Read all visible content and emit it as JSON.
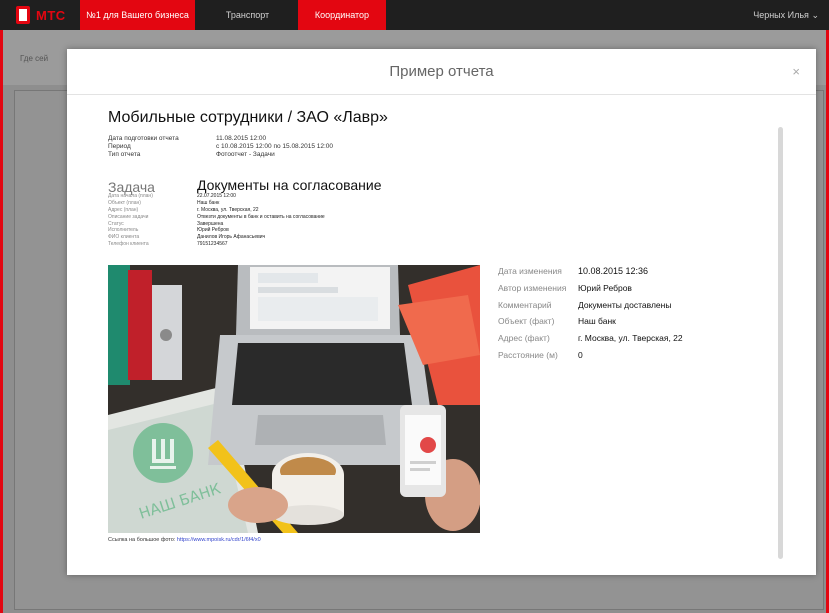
{
  "topbar": {
    "logo_text": "МТС",
    "tabs": [
      "№1 для Вашего бизнеса",
      "Транспорт",
      "Координатор"
    ],
    "user_name": "Черных Илья"
  },
  "background": {
    "where_label": "Где сей"
  },
  "modal": {
    "title": "Пример отчета",
    "close_glyph": "×"
  },
  "report": {
    "title": "Мобильные сотрудники / ЗАО «Лавр»",
    "meta": [
      {
        "key": "Дата подготовки отчета",
        "value": "11.08.2015 12:00"
      },
      {
        "key": "Период",
        "value": "с 10.08.2015 12:00 по 15.08.2015 12:00"
      },
      {
        "key": "Тип отчета",
        "value": "Фотоотчет - Задачи"
      }
    ],
    "task_label": "Задача",
    "task_title": "Документы на согласование",
    "details": [
      {
        "key": "Дата начала (план)",
        "value": "22.07.2015 12:00"
      },
      {
        "key": "Объект (план)",
        "value": "Наш банк"
      },
      {
        "key": "Адрес (план)",
        "value": "г. Москва, ул. Тверская, 22"
      },
      {
        "key": "Описание задачи",
        "value": "Отвезти документы в банк и оставить на согласование"
      },
      {
        "key": "Статус",
        "value": "Завершена"
      },
      {
        "key": "Исполнитель",
        "value": "Юрий Ребров"
      },
      {
        "key": "ФИО клиента",
        "value": "Данилов Игорь Афанасьевич"
      },
      {
        "key": "Телефон клиента",
        "value": "79151234567"
      }
    ],
    "photo": {
      "sign_text": "НАШ БАНК",
      "link_label": "Ссылка на большое фото:",
      "link_url": "https://www.mpoisk.ru/cdr/1/6f4/x0"
    },
    "changes": [
      {
        "key": "Дата изменения",
        "value": "10.08.2015 12:36"
      },
      {
        "key": "Автор изменения",
        "value": "Юрий Ребров"
      },
      {
        "key": "Комментарий",
        "value": "Документы доставлены"
      },
      {
        "key": "Объект (факт)",
        "value": "Наш банк"
      },
      {
        "key": "Адрес (факт)",
        "value": "г. Москва, ул. Тверская, 22"
      },
      {
        "key": "Расстояние (м)",
        "value": "0"
      }
    ]
  },
  "colors": {
    "brand_red": "#e30611",
    "topbar_bg": "#1f1f1f"
  }
}
